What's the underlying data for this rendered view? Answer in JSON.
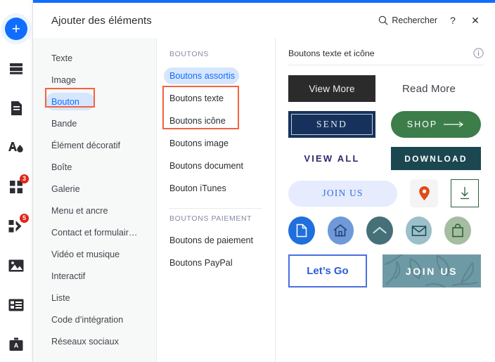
{
  "rail": {
    "items": [
      {
        "name": "add-element",
        "icon": "plus-icon",
        "badge": null
      },
      {
        "name": "sections",
        "icon": "sections-icon",
        "badge": null
      },
      {
        "name": "pages",
        "icon": "page-icon",
        "badge": null
      },
      {
        "name": "theme",
        "icon": "theme-icon",
        "badge": null
      },
      {
        "name": "apps",
        "icon": "apps-grid-icon",
        "badge": "3"
      },
      {
        "name": "business-tools",
        "icon": "puzzle-icon",
        "badge": "5"
      },
      {
        "name": "media",
        "icon": "image-icon",
        "badge": null
      },
      {
        "name": "layouts",
        "icon": "layout-icon",
        "badge": null
      },
      {
        "name": "blog",
        "icon": "briefcase-icon",
        "badge": null
      }
    ]
  },
  "header": {
    "title": "Ajouter des éléments",
    "search_label": "Rechercher",
    "help_label": "?",
    "close_label": "✕"
  },
  "categories": {
    "items": [
      {
        "label": "Texte",
        "selected": false
      },
      {
        "label": "Image",
        "selected": false
      },
      {
        "label": "Bouton",
        "selected": true
      },
      {
        "label": "Bande",
        "selected": false
      },
      {
        "label": "Élément décoratif",
        "selected": false
      },
      {
        "label": "Boîte",
        "selected": false
      },
      {
        "label": "Galerie",
        "selected": false
      },
      {
        "label": "Menu et ancre",
        "selected": false
      },
      {
        "label": "Contact et formulair…",
        "selected": false
      },
      {
        "label": "Vidéo et musique",
        "selected": false
      },
      {
        "label": "Interactif",
        "selected": false
      },
      {
        "label": "Liste",
        "selected": false
      },
      {
        "label": "Code d’intégration",
        "selected": false
      },
      {
        "label": "Réseaux sociaux",
        "selected": false
      }
    ]
  },
  "subcategories": {
    "group1_title": "BOUTONS",
    "group1": [
      {
        "label": "Boutons assortis",
        "selected": true
      },
      {
        "label": "Boutons texte",
        "selected": false
      },
      {
        "label": "Boutons icône",
        "selected": false
      },
      {
        "label": "Boutons image",
        "selected": false
      },
      {
        "label": "Boutons document",
        "selected": false
      },
      {
        "label": "Bouton iTunes",
        "selected": false
      }
    ],
    "group2_title": "BOUTONS PAIEMENT",
    "group2": [
      {
        "label": "Boutons de paiement",
        "selected": false
      },
      {
        "label": "Boutons PayPal",
        "selected": false
      }
    ]
  },
  "preview": {
    "section_title": "Boutons texte et icône",
    "info_icon": "info-icon",
    "buttons": {
      "view_more": "View More",
      "read_more": "Read More",
      "send": "SEND",
      "shop": "SHOP",
      "view_all": "VIEW ALL",
      "download": "DOWNLOAD",
      "join_us_pill": "JOIN US",
      "lets_go": "Let’s Go",
      "join_us_image": "JOIN US"
    },
    "icon_buttons": [
      {
        "name": "document-icon-button",
        "icon": "document-icon",
        "color": "#1f6fdd"
      },
      {
        "name": "home-icon-button",
        "icon": "home-icon",
        "color": "#6e9ad9"
      },
      {
        "name": "chevron-up-icon-button",
        "icon": "chevron-up-icon",
        "color": "#467078"
      },
      {
        "name": "envelope-icon-button",
        "icon": "envelope-icon",
        "color": "#9cc0c9"
      },
      {
        "name": "bag-icon-button",
        "icon": "shopping-bag-icon",
        "color": "#a5bda0"
      }
    ],
    "small_buttons": [
      {
        "name": "location-pin-button",
        "icon": "location-pin-icon",
        "color": "#e04b16"
      },
      {
        "name": "download-box-button",
        "icon": "download-arrow-icon",
        "color": "#2f5d3a"
      }
    ]
  },
  "colors": {
    "accent_blue": "#116dff",
    "pill_blue": "#d6e6fe",
    "annotation_red": "#f4613f",
    "panel_bg_grey": "#f7f8f8",
    "text_dark": "#2b2d33",
    "text_muted": "#868aa5"
  }
}
